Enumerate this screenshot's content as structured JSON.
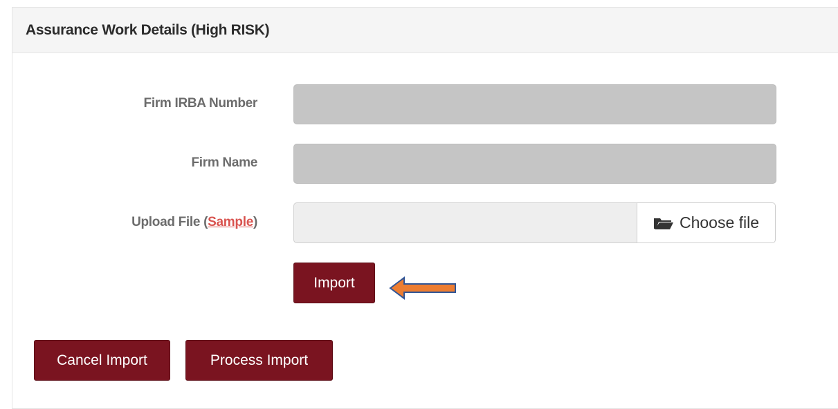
{
  "panel": {
    "title": "Assurance Work Details (High RISK)"
  },
  "form": {
    "firm_irba_label": "Firm IRBA Number",
    "firm_irba_value": "",
    "firm_name_label": "Firm Name",
    "firm_name_value": "",
    "upload_label_prefix": "Upload File (",
    "upload_sample_link": "Sample",
    "upload_label_suffix": ")",
    "choose_file_label": "Choose file",
    "choose_file_icon": "folder-open-icon"
  },
  "buttons": {
    "import_label": "Import",
    "cancel_import_label": "Cancel Import",
    "process_import_label": "Process Import"
  },
  "colors": {
    "button_maroon": "#7a1420",
    "link_red": "#d9534f",
    "annotation_arrow_fill": "#ed7d31",
    "annotation_arrow_stroke": "#2f5597"
  }
}
